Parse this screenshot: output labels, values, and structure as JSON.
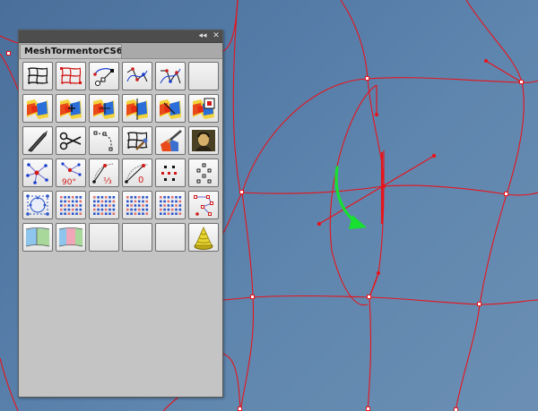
{
  "panel": {
    "tab_title": "MeshTormentorCS6",
    "collapse_glyph": "◂◂",
    "close_glyph": "✕"
  },
  "colors": {
    "mesh_line": "#e8141c",
    "arrow": "#18e030",
    "canvas": "#567ea9",
    "panel_bg": "#c4c4c4"
  },
  "tools": [
    {
      "icon": "warp-mesh-icon"
    },
    {
      "icon": "red-warp-mesh-icon"
    },
    {
      "icon": "node-path-icon"
    },
    {
      "icon": "bezier-nodes-icon"
    },
    {
      "icon": "bezier-nodes-alt-icon"
    },
    {
      "icon": "empty-slot"
    },
    {
      "icon": "gradient-mesh-icon"
    },
    {
      "icon": "gradient-mesh-add-icon"
    },
    {
      "icon": "gradient-mesh-move-icon"
    },
    {
      "icon": "gradient-mesh-split-icon"
    },
    {
      "icon": "gradient-mesh-edit-icon"
    },
    {
      "icon": "gradient-mesh-frame-icon"
    },
    {
      "icon": "knife-icon"
    },
    {
      "icon": "scissors-icon"
    },
    {
      "icon": "curve-dashed-icon"
    },
    {
      "icon": "paint-mesh-icon"
    },
    {
      "icon": "brush-gradient-icon"
    },
    {
      "icon": "mona-lisa-warp-icon"
    },
    {
      "icon": "star-nodes-icon"
    },
    {
      "icon": "rotate-90-icon",
      "label": "90°"
    },
    {
      "icon": "thirds-curve-icon",
      "label": "1/3"
    },
    {
      "icon": "zero-curve-icon",
      "label": "0"
    },
    {
      "icon": "dot-grid-red-icon"
    },
    {
      "icon": "dot-grid-black-icon"
    },
    {
      "icon": "mesh-circle-icon"
    },
    {
      "icon": "blue-grid-icon"
    },
    {
      "icon": "blue-grid-icon-2"
    },
    {
      "icon": "blue-grid-icon-3"
    },
    {
      "icon": "blue-grid-icon-4"
    },
    {
      "icon": "zigzag-path-icon"
    },
    {
      "icon": "colored-patch-icon"
    },
    {
      "icon": "colored-patch-pink-icon"
    },
    {
      "icon": "empty-slot"
    },
    {
      "icon": "empty-slot"
    },
    {
      "icon": "empty-slot"
    },
    {
      "icon": "cone-icon"
    }
  ]
}
